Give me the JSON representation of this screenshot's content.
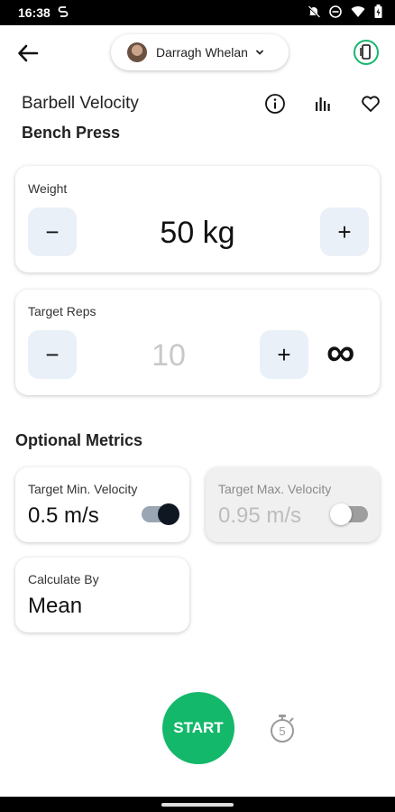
{
  "status_bar": {
    "time": "16:38",
    "left_icon": "sync-icon",
    "right_icons": [
      "mute-icon",
      "do-not-disturb-icon",
      "wifi-icon",
      "battery-icon"
    ]
  },
  "header": {
    "user_name": "Darragh Whelan",
    "accent_color": "#18b66f"
  },
  "exercise": {
    "title": "Barbell Velocity",
    "name": "Bench Press"
  },
  "weight": {
    "label": "Weight",
    "value": "50 kg",
    "minus": "−",
    "plus": "+"
  },
  "reps": {
    "label": "Target Reps",
    "value": "10",
    "minus": "−",
    "plus": "+",
    "infinity": "∞"
  },
  "optional_metrics": {
    "title": "Optional Metrics",
    "min_velocity": {
      "label": "Target Min. Velocity",
      "value": "0.5 m/s",
      "enabled": true
    },
    "max_velocity": {
      "label": "Target Max. Velocity",
      "value": "0.95 m/s",
      "enabled": false
    },
    "calculate_by": {
      "label": "Calculate By",
      "value": "Mean"
    }
  },
  "actions": {
    "start_label": "START",
    "start_color": "#14b86b",
    "countdown": "5"
  }
}
